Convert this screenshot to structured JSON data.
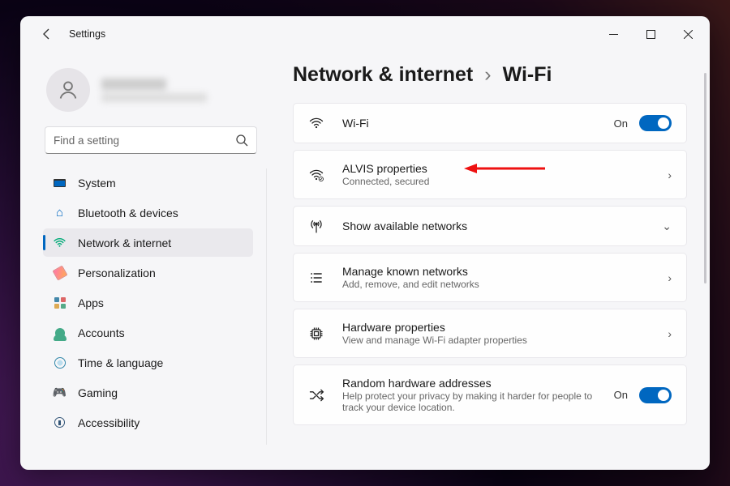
{
  "window": {
    "title": "Settings"
  },
  "search": {
    "placeholder": "Find a setting"
  },
  "sidebar": {
    "items": [
      {
        "label": "System"
      },
      {
        "label": "Bluetooth & devices"
      },
      {
        "label": "Network & internet"
      },
      {
        "label": "Personalization"
      },
      {
        "label": "Apps"
      },
      {
        "label": "Accounts"
      },
      {
        "label": "Time & language"
      },
      {
        "label": "Gaming"
      },
      {
        "label": "Accessibility"
      }
    ]
  },
  "breadcrumb": {
    "parent": "Network & internet",
    "sep": "›",
    "current": "Wi-Fi"
  },
  "cards": {
    "wifi": {
      "title": "Wi-Fi",
      "state": "On"
    },
    "network": {
      "title": "ALVIS properties",
      "sub": "Connected, secured"
    },
    "available": {
      "title": "Show available networks"
    },
    "known": {
      "title": "Manage known networks",
      "sub": "Add, remove, and edit networks"
    },
    "hardware": {
      "title": "Hardware properties",
      "sub": "View and manage Wi-Fi adapter properties"
    },
    "random": {
      "title": "Random hardware addresses",
      "sub": "Help protect your privacy by making it harder for people to track your device location.",
      "state": "On"
    }
  }
}
